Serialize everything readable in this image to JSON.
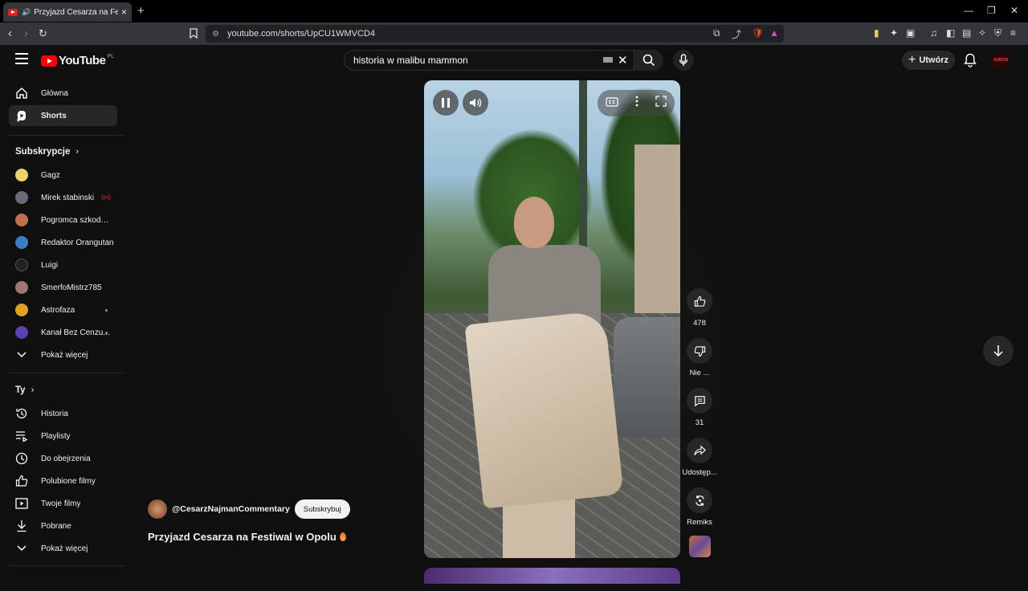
{
  "browser": {
    "tab_title": "Przyjazd Cesarza na Festiwal w Opolu",
    "new_tab": "+",
    "tab_close": "×",
    "window_controls": {
      "minimize": "—",
      "restore": "❐",
      "close": "✕"
    },
    "url": "youtube.com/shorts/UpCU1WMVCD4"
  },
  "masthead": {
    "logo": "YouTube",
    "country_code": "PL",
    "search_value": "historia w malibu mammon",
    "create_label": "Utwórz",
    "avatar_text": "ADRON"
  },
  "sidebar": {
    "main": [
      {
        "label": "Główna",
        "icon": "home-icon"
      },
      {
        "label": "Shorts",
        "icon": "shorts-icon",
        "active": true
      }
    ],
    "subscriptions_title": "Subskrypcje",
    "subscriptions": [
      {
        "label": "Gagz",
        "color": "#e8d36a"
      },
      {
        "label": "Mirek stabinski",
        "color": "#6a6a7a",
        "live": "((•))"
      },
      {
        "label": "Pogromca szkodni...",
        "color": "#c0704a"
      },
      {
        "label": "Redaktor Orangutan",
        "color": "#3a80c0"
      },
      {
        "label": "Luigi",
        "color": "#222222"
      },
      {
        "label": "SmerfoMistrz785",
        "color": "#9a7a6a"
      },
      {
        "label": "Astrofaza",
        "color": "#e0a020",
        "dot": true
      },
      {
        "label": "Kanał Bez Cenzu...",
        "color": "#5a40b0",
        "dot": true
      }
    ],
    "show_more_1": "Pokaż więcej",
    "you_title": "Ty",
    "you": [
      {
        "label": "Historia",
        "icon": "history-icon"
      },
      {
        "label": "Playlisty",
        "icon": "playlist-icon"
      },
      {
        "label": "Do obejrzenia",
        "icon": "clock-icon"
      },
      {
        "label": "Polubione filmy",
        "icon": "thumb-up-icon"
      },
      {
        "label": "Twoje filmy",
        "icon": "your-videos-icon"
      },
      {
        "label": "Pobrane",
        "icon": "download-icon"
      }
    ],
    "show_more_2": "Pokaż więcej"
  },
  "short": {
    "channel": "@CesarzNajmanCommentary",
    "subscribe_label": "Subskrybuj",
    "title": "Przyjazd Cesarza na Festiwal w Opolu",
    "actions": {
      "likes": "478",
      "dislike": "Nie ...",
      "comments": "31",
      "share": "Udostęp...",
      "remix": "Remiks"
    }
  }
}
